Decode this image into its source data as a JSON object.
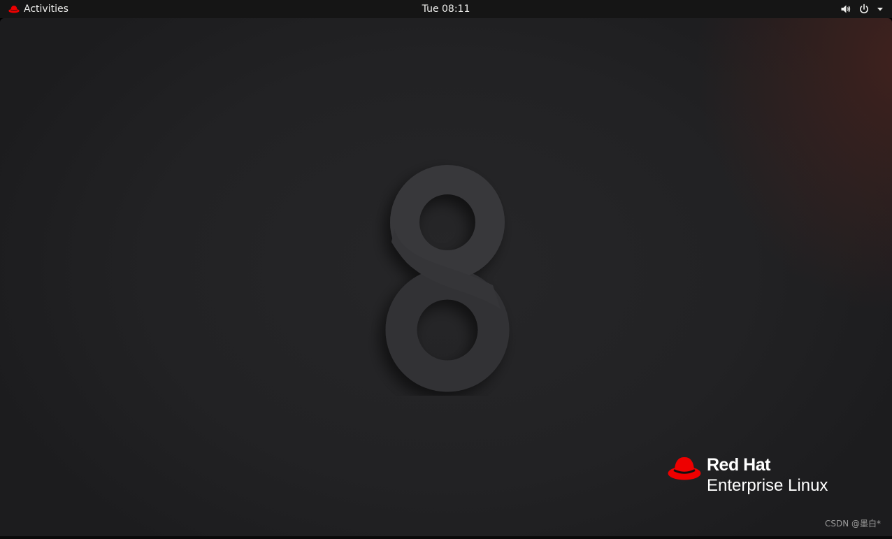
{
  "topbar": {
    "activities_label": "Activities",
    "clock": "Tue 08:11",
    "icons": [
      "redhat-hat-icon",
      "volume-icon",
      "power-icon",
      "dropdown-arrow-icon"
    ]
  },
  "desktop": {
    "wallpaper_numeral": "8",
    "brand_line1": "Red Hat",
    "brand_line2": "Enterprise Linux",
    "watermark": "CSDN @墨白*"
  },
  "colors": {
    "topbar_bg": "#151515",
    "desktop_bg": "#232325",
    "brand_red": "#ee0000",
    "text": "#eeeeec"
  }
}
